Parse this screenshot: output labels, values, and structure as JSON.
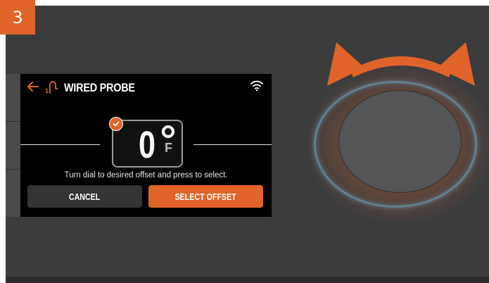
{
  "step": {
    "number": "3"
  },
  "screen": {
    "header": {
      "back_icon": "arrow-left-icon",
      "probe_icon": "probe-1-icon",
      "title": "WIRED PROBE",
      "wifi_icon": "wifi-icon"
    },
    "offset": {
      "value": "0",
      "unit": "F",
      "selected_icon": "check-icon"
    },
    "instruction": "Turn dial to desired offset and press to select.",
    "buttons": {
      "cancel_label": "CANCEL",
      "select_label": "SELECT OFFSET"
    }
  },
  "dial": {
    "rotate_icon": "double-curved-arrow-icon"
  },
  "colors": {
    "accent": "#e0642a",
    "device_body": "#3b3c3e",
    "screen_bg": "#000000",
    "knob": "#545557",
    "ring_glow": "#6896af"
  }
}
